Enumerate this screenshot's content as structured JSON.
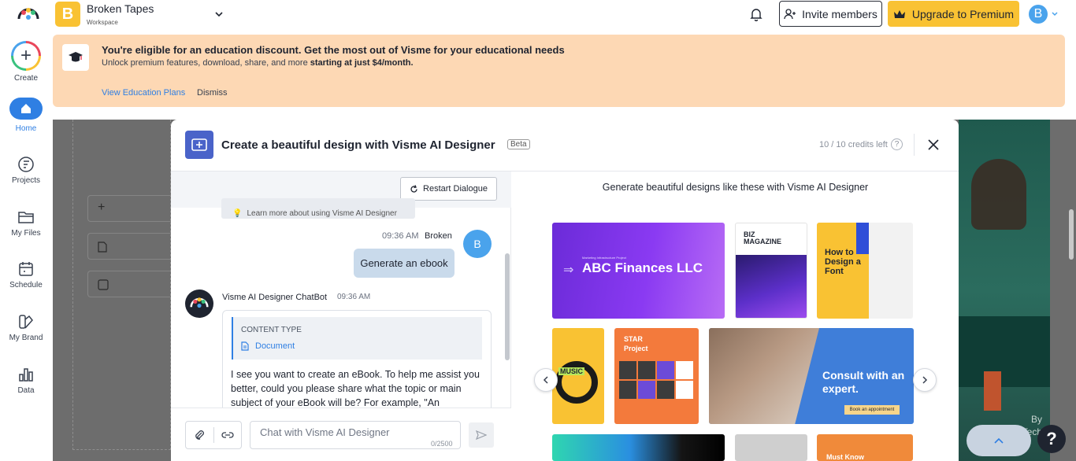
{
  "workspace": {
    "initial": "B",
    "name": "Broken Tapes",
    "label": "Workspace"
  },
  "header": {
    "invite_label": "Invite members",
    "upgrade_label": "Upgrade to Premium",
    "avatar_initial": "B"
  },
  "sidebar": {
    "items": [
      {
        "label": "Create"
      },
      {
        "label": "Home"
      },
      {
        "label": "Projects"
      },
      {
        "label": "My Files"
      },
      {
        "label": "Schedule"
      },
      {
        "label": "My Brand"
      },
      {
        "label": "Data"
      }
    ]
  },
  "banner": {
    "title": "You're eligible for an education discount. Get the most out of Visme for your educational needs",
    "subtitle": "Unlock premium features, download, share, and more",
    "subtitle_bold": "starting at just $4/month.",
    "link_label": "View Education Plans",
    "dismiss_label": "Dismiss"
  },
  "backdrop": {
    "byline_1": "By",
    "byline_2": "GigaTech"
  },
  "modal": {
    "title": "Create a beautiful design with Visme AI Designer",
    "badge": "Beta",
    "credits": "10 / 10 credits left",
    "help": "?"
  },
  "chat": {
    "restart_label": "Restart Dialogue",
    "learn_more": "Learn more about using Visme AI Designer",
    "user_time": "09:36 AM",
    "user_name": "Broken",
    "user_initial": "B",
    "user_message": "Generate an ebook",
    "bot_name": "Visme AI Designer ChatBot",
    "bot_time": "09:36 AM",
    "content_type_label": "CONTENT TYPE",
    "content_type_value": "Document",
    "bot_message": "I see you want to create an eBook. To help me assist you better, could you please share what the topic or main subject of your eBook will be? For example, \"An",
    "input_placeholder": "Chat with Visme AI Designer",
    "char_count": "0/2500"
  },
  "gallery": {
    "title": "Generate beautiful designs like these with Visme AI Designer",
    "tiles": {
      "t1_title": "ABC Finances LLC",
      "t1_sub": "Marketing Infrastructure Project",
      "t2_title": "BIZ MAGAZINE",
      "t3_title": "How to Design a Font",
      "t4_label": "MUSIC",
      "t5_title": "STAR Project",
      "t6_title": "Consult with an expert.",
      "t6_cta": "Book an appointment",
      "t9_label": "Must Know"
    }
  },
  "help_button": "?",
  "colors": {
    "brand_blue": "#2f7fe3",
    "premium_yellow": "#f9c233",
    "banner_peach": "#fdd8b4",
    "modal_icon": "#4a63c9"
  }
}
